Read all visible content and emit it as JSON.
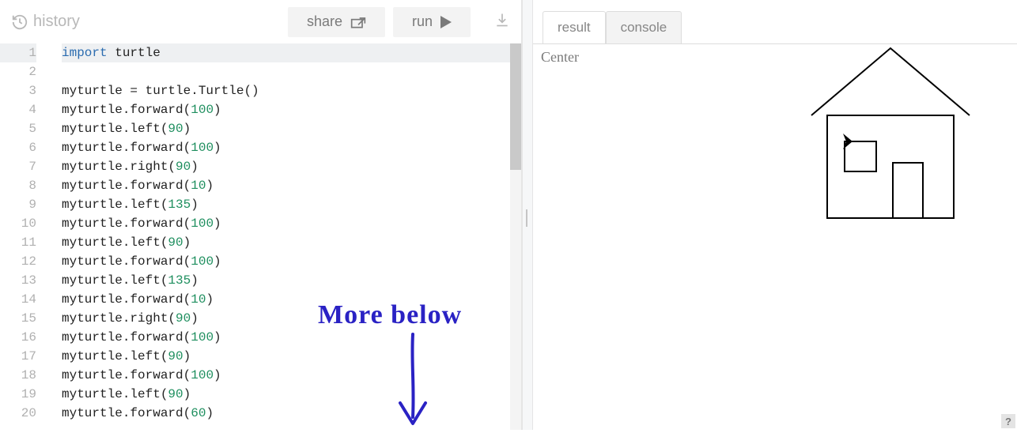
{
  "toolbar": {
    "history_label": "history",
    "share_label": "share",
    "run_label": "run"
  },
  "tabs": {
    "result": "result",
    "console": "console",
    "active": "result"
  },
  "output_label": "Center",
  "annotation": "More  below",
  "help_label": "?",
  "code": [
    {
      "n": 1,
      "tokens": [
        {
          "t": "import",
          "c": "kw"
        },
        {
          "t": " turtle",
          "c": ""
        }
      ]
    },
    {
      "n": 2,
      "tokens": []
    },
    {
      "n": 3,
      "tokens": [
        {
          "t": "myturtle = turtle.Turtle()",
          "c": ""
        }
      ]
    },
    {
      "n": 4,
      "tokens": [
        {
          "t": "myturtle.forward(",
          "c": ""
        },
        {
          "t": "100",
          "c": "num"
        },
        {
          "t": ")",
          "c": ""
        }
      ]
    },
    {
      "n": 5,
      "tokens": [
        {
          "t": "myturtle.left(",
          "c": ""
        },
        {
          "t": "90",
          "c": "num"
        },
        {
          "t": ")",
          "c": ""
        }
      ]
    },
    {
      "n": 6,
      "tokens": [
        {
          "t": "myturtle.forward(",
          "c": ""
        },
        {
          "t": "100",
          "c": "num"
        },
        {
          "t": ")",
          "c": ""
        }
      ]
    },
    {
      "n": 7,
      "tokens": [
        {
          "t": "myturtle.right(",
          "c": ""
        },
        {
          "t": "90",
          "c": "num"
        },
        {
          "t": ")",
          "c": ""
        }
      ]
    },
    {
      "n": 8,
      "tokens": [
        {
          "t": "myturtle.forward(",
          "c": ""
        },
        {
          "t": "10",
          "c": "num"
        },
        {
          "t": ")",
          "c": ""
        }
      ]
    },
    {
      "n": 9,
      "tokens": [
        {
          "t": "myturtle.left(",
          "c": ""
        },
        {
          "t": "135",
          "c": "num"
        },
        {
          "t": ")",
          "c": ""
        }
      ]
    },
    {
      "n": 10,
      "tokens": [
        {
          "t": "myturtle.forward(",
          "c": ""
        },
        {
          "t": "100",
          "c": "num"
        },
        {
          "t": ")",
          "c": ""
        }
      ]
    },
    {
      "n": 11,
      "tokens": [
        {
          "t": "myturtle.left(",
          "c": ""
        },
        {
          "t": "90",
          "c": "num"
        },
        {
          "t": ")",
          "c": ""
        }
      ]
    },
    {
      "n": 12,
      "tokens": [
        {
          "t": "myturtle.forward(",
          "c": ""
        },
        {
          "t": "100",
          "c": "num"
        },
        {
          "t": ")",
          "c": ""
        }
      ]
    },
    {
      "n": 13,
      "tokens": [
        {
          "t": "myturtle.left(",
          "c": ""
        },
        {
          "t": "135",
          "c": "num"
        },
        {
          "t": ")",
          "c": ""
        }
      ]
    },
    {
      "n": 14,
      "tokens": [
        {
          "t": "myturtle.forward(",
          "c": ""
        },
        {
          "t": "10",
          "c": "num"
        },
        {
          "t": ")",
          "c": ""
        }
      ]
    },
    {
      "n": 15,
      "tokens": [
        {
          "t": "myturtle.right(",
          "c": ""
        },
        {
          "t": "90",
          "c": "num"
        },
        {
          "t": ")",
          "c": ""
        }
      ]
    },
    {
      "n": 16,
      "tokens": [
        {
          "t": "myturtle.forward(",
          "c": ""
        },
        {
          "t": "100",
          "c": "num"
        },
        {
          "t": ")",
          "c": ""
        }
      ]
    },
    {
      "n": 17,
      "tokens": [
        {
          "t": "myturtle.left(",
          "c": ""
        },
        {
          "t": "90",
          "c": "num"
        },
        {
          "t": ")",
          "c": ""
        }
      ]
    },
    {
      "n": 18,
      "tokens": [
        {
          "t": "myturtle.forward(",
          "c": ""
        },
        {
          "t": "100",
          "c": "num"
        },
        {
          "t": ")",
          "c": ""
        }
      ]
    },
    {
      "n": 19,
      "tokens": [
        {
          "t": "myturtle.left(",
          "c": ""
        },
        {
          "t": "90",
          "c": "num"
        },
        {
          "t": ")",
          "c": ""
        }
      ]
    },
    {
      "n": 20,
      "tokens": [
        {
          "t": "myturtle.forward(",
          "c": ""
        },
        {
          "t": "60",
          "c": "num"
        },
        {
          "t": ")",
          "c": ""
        }
      ]
    }
  ]
}
